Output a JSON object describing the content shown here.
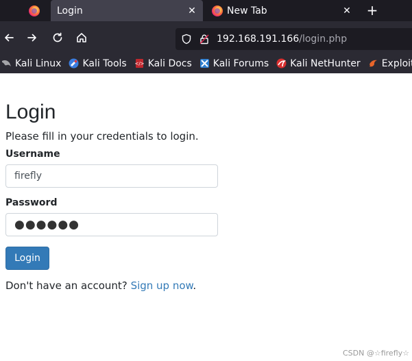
{
  "browser": {
    "tabs": [
      {
        "title": "",
        "icon": "firefox-icon",
        "pinned": true
      },
      {
        "title": "Login",
        "icon": "",
        "active": true
      },
      {
        "title": "New Tab",
        "icon": "firefox-icon",
        "active": false
      }
    ],
    "url": {
      "host": "192.168.191.166",
      "path": "/login.php"
    },
    "bookmarks": [
      {
        "label": "Kali Linux",
        "icon": "kali-dragon-icon"
      },
      {
        "label": "Kali Tools",
        "icon": "kali-tools-icon"
      },
      {
        "label": "Kali Docs",
        "icon": "kali-docs-icon"
      },
      {
        "label": "Kali Forums",
        "icon": "kali-forums-icon"
      },
      {
        "label": "Kali NetHunter",
        "icon": "kali-nethunter-icon"
      },
      {
        "label": "Exploit-DB",
        "icon": "exploit-db-icon"
      }
    ],
    "colors": {
      "tabbar": "#1c1b22",
      "toolbar": "#2b2a33",
      "active_tab": "#42414d"
    }
  },
  "page": {
    "title": "Login",
    "subtitle": "Please fill in your credentials to login.",
    "username": {
      "label": "Username",
      "value": "firefly"
    },
    "password": {
      "label": "Password",
      "value": "●●●●●●"
    },
    "login_button": "Login",
    "signup_prompt": "Don't have an account?",
    "signup_link": "Sign up now",
    "signup_suffix": ".",
    "watermark": "CSDN @☆firefly☆"
  },
  "colors": {
    "primary": "#337ab7",
    "text": "#212529"
  }
}
